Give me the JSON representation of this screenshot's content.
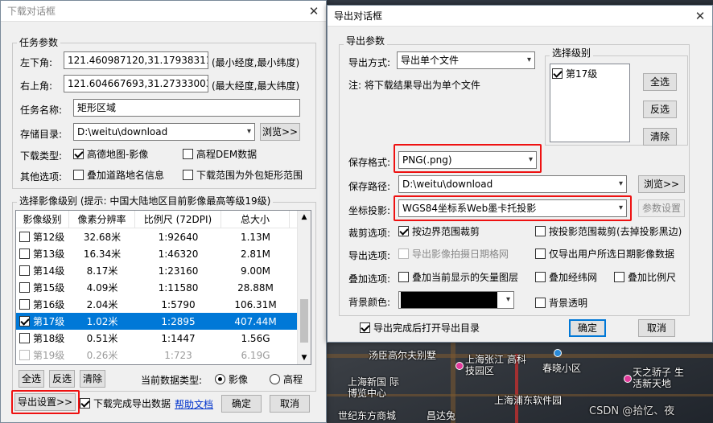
{
  "map": {
    "labels": [
      "汤臣高尔夫别墅",
      "上海张江 高科技园区",
      "上海新国 际博览中心",
      "上海浦东软件园",
      "春晓小区",
      "天之骄子 生活新天地",
      "世纪东方商城",
      "昌达兔"
    ],
    "watermark": "CSDN @拾忆、夜"
  },
  "download_dialog": {
    "title": "下载对话框",
    "task_group": "任务参数",
    "lower_left_label": "左下角:",
    "lower_left_value": "121.460987120,31.179383117",
    "lower_left_hint": "(最小经度,最小纬度)",
    "upper_right_label": "右上角:",
    "upper_right_value": "121.604667693,31.273330033",
    "upper_right_hint": "(最大经度,最大纬度)",
    "task_name_label": "任务名称:",
    "task_name_value": "矩形区域",
    "storage_label": "存储目录:",
    "storage_value": "D:\\weitu\\download",
    "browse": "浏览>>",
    "download_type_label": "下载类型:",
    "type_gaode": "高德地图-影像",
    "type_dem": "高程DEM数据",
    "other_label": "其他选项:",
    "opt_roads": "叠加道路地名信息",
    "opt_range": "下载范围为外包矩形范围",
    "level_group": "选择影像级别 (提示: 中国大陆地区目前影像最高等级19级)",
    "columns": [
      "影像级别",
      "像素分辨率",
      "比例尺 (72DPI)",
      "总大小"
    ],
    "rows": [
      {
        "level": "第12级",
        "res": "32.68米",
        "scale": "1:92640",
        "size": "1.13M",
        "checked": false,
        "selected": false,
        "gray": false
      },
      {
        "level": "第13级",
        "res": "16.34米",
        "scale": "1:46320",
        "size": "2.81M",
        "checked": false,
        "selected": false,
        "gray": false
      },
      {
        "level": "第14级",
        "res": "8.17米",
        "scale": "1:23160",
        "size": "9.00M",
        "checked": false,
        "selected": false,
        "gray": false
      },
      {
        "level": "第15级",
        "res": "4.09米",
        "scale": "1:11580",
        "size": "28.88M",
        "checked": false,
        "selected": false,
        "gray": false
      },
      {
        "level": "第16级",
        "res": "2.04米",
        "scale": "1:5790",
        "size": "106.31M",
        "checked": false,
        "selected": false,
        "gray": false
      },
      {
        "level": "第17级",
        "res": "1.02米",
        "scale": "1:2895",
        "size": "407.44M",
        "checked": true,
        "selected": true,
        "gray": false
      },
      {
        "level": "第18级",
        "res": "0.51米",
        "scale": "1:1447",
        "size": "1.56G",
        "checked": false,
        "selected": false,
        "gray": false
      },
      {
        "level": "第19级",
        "res": "0.26米",
        "scale": "1:723",
        "size": "6.19G",
        "checked": false,
        "selected": false,
        "gray": true
      }
    ],
    "select_all": "全选",
    "invert": "反选",
    "clear": "清除",
    "data_type_label": "当前数据类型:",
    "radio_image": "影像",
    "radio_elev": "高程",
    "export_settings": "导出设置>>",
    "export_after": "下载完成导出数据",
    "help": "帮助文档",
    "ok": "确定",
    "cancel": "取消"
  },
  "export_dialog": {
    "title": "导出对话框",
    "params_group": "导出参数",
    "mode_label": "导出方式:",
    "mode_value": "导出单个文件",
    "note": "注: 将下载结果导出为单个文件",
    "level_group": "选择级别",
    "level_item": "第17级",
    "select_all": "全选",
    "invert": "反选",
    "clear": "清除",
    "format_label": "保存格式:",
    "format_value": "PNG(.png)",
    "path_label": "保存路径:",
    "path_value": "D:\\weitu\\download",
    "browse": "浏览>>",
    "proj_label": "坐标投影:",
    "proj_value": "WGS84坐标系Web墨卡托投影",
    "param_settings": "参数设置",
    "crop_label": "裁剪选项:",
    "crop_boundary": "按边界范围裁剪",
    "crop_proj": "按投影范围裁剪(去掉投影黑边)",
    "export_opt_label": "导出选项:",
    "export_date": "导出影像拍摄日期格网",
    "export_user_date": "仅导出用户所选日期影像数据",
    "overlay_label": "叠加选项:",
    "overlay_vector": "叠加当前显示的矢量图层",
    "overlay_grid": "叠加经纬网",
    "overlay_scale": "叠加比例尺",
    "bg_label": "背景颜色:",
    "bg_transparent": "背景透明",
    "open_after": "导出完成后打开导出目录",
    "ok": "确定",
    "cancel": "取消"
  },
  "colors": {
    "accent": "#0078d7",
    "highlight": "#e11111",
    "bg_color": "#000000"
  }
}
